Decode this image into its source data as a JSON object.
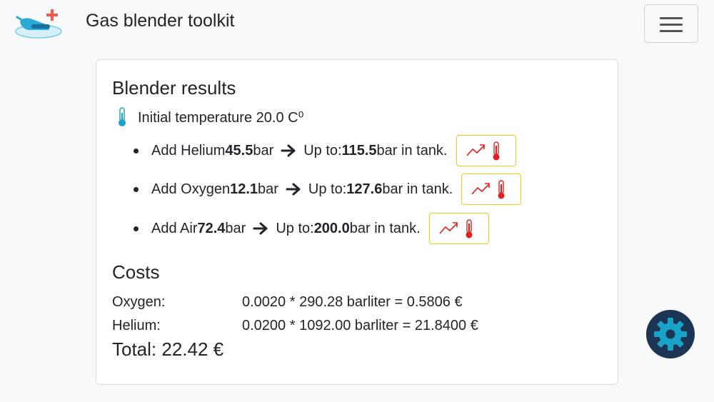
{
  "app": {
    "brand": "Gas blender toolkit",
    "menu_icon": "hamburger-icon",
    "logo_icon": "diver-plus-logo"
  },
  "results": {
    "title": "Blender results",
    "temperature_label": "Initial temperature 20.0 C⁰",
    "steps": [
      {
        "prefix": "Add Helium ",
        "amount": "45.5",
        "amount_unit": " bar",
        "upto_label": "Up to: ",
        "upto_value": "115.5",
        "upto_suffix": " bar in tank."
      },
      {
        "prefix": "Add Oxygen ",
        "amount": "12.1",
        "amount_unit": " bar",
        "upto_label": "Up to: ",
        "upto_value": "127.6",
        "upto_suffix": " bar in tank."
      },
      {
        "prefix": "Add Air ",
        "amount": "72.4",
        "amount_unit": " bar",
        "upto_label": "Up to: ",
        "upto_value": "200.0",
        "upto_suffix": " bar in tank."
      }
    ]
  },
  "costs": {
    "title": "Costs",
    "rows": [
      {
        "label": "Oxygen:",
        "calc": "0.0020 * 290.28 barliter = 0.5806 €"
      },
      {
        "label": "Helium:",
        "calc": "0.0200 * 1092.00 barliter = 21.8400 €"
      }
    ],
    "total": "Total: 22.42 €"
  },
  "colors": {
    "accent_yellow": "#f5c518",
    "thermo_red": "#e02020",
    "thermo_blue": "#1aa3c8",
    "fab_bg": "#1c3554",
    "fab_gear": "#1aa3c8"
  }
}
